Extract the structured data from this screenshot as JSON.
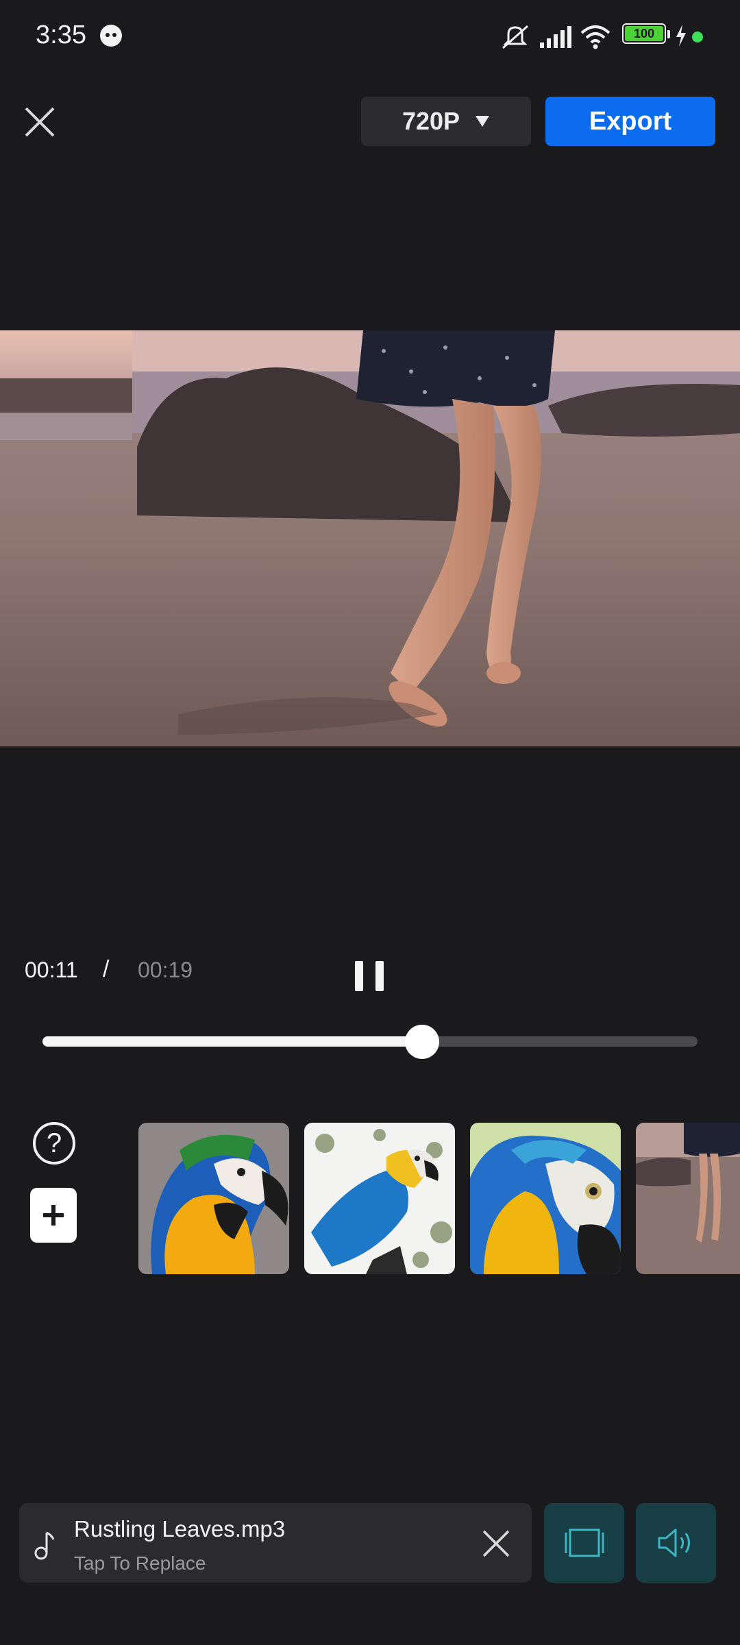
{
  "status_bar": {
    "time": "3:35",
    "battery_level": "100",
    "icons": [
      "notification-face-icon",
      "mute-icon",
      "signal-icon",
      "wifi-icon",
      "battery-icon",
      "charging-icon",
      "active-dot-icon"
    ]
  },
  "top_bar": {
    "close_icon": "close-icon",
    "resolution": "720P",
    "resolution_dropdown_icon": "triangle-down-icon",
    "export_label": "Export"
  },
  "preview": {
    "description_icon": "video-frame"
  },
  "playback": {
    "current_time": "00:11",
    "separator": "/",
    "total_time": "00:19",
    "progress": 0.58,
    "state": "playing"
  },
  "actions": {
    "help_label": "?",
    "add_icon": "plus-icon"
  },
  "clips": [
    {
      "name": "clip-parrot-1"
    },
    {
      "name": "clip-parrot-2"
    },
    {
      "name": "clip-parrot-3"
    },
    {
      "name": "clip-beach"
    }
  ],
  "music": {
    "title": "Rustling Leaves.mp3",
    "subtitle": "Tap To Replace",
    "icon": "music-note-icon"
  },
  "colors": {
    "background": "#1a1a1d",
    "accent": "#0c6cf0",
    "teal_button": "#173e45",
    "teal_icon": "#3fb6c4"
  }
}
